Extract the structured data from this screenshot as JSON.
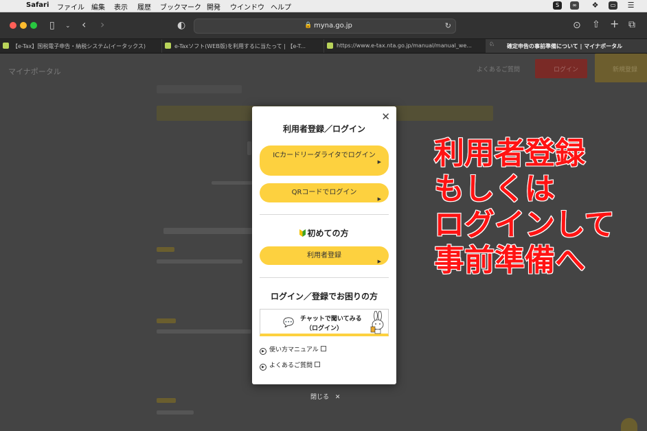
{
  "menubar": {
    "app": "Safari",
    "items": [
      "ファイル",
      "編集",
      "表示",
      "履歴",
      "ブックマーク",
      "開発",
      "ウインドウ",
      "ヘルプ"
    ]
  },
  "toolbar": {
    "url": "myna.go.jp"
  },
  "tabs": [
    {
      "label": "【e-Tax】国税電子申告・納税システム(イータックス)"
    },
    {
      "label": "e-Taxソフト(WEB版)を利用するに当たって | 【e-T..."
    },
    {
      "label": "https://www.e-tax.nta.go.jp/manual/manual_we..."
    },
    {
      "label": "確定申告の事前準備について | マイナポータル"
    }
  ],
  "background": {
    "logo": "マイナポータル",
    "faq": "よくあるご質問",
    "login": "ログイン",
    "register": "新規登録"
  },
  "modal": {
    "title": "利用者登録／ログイン",
    "ic_login": "ICカードリーダライタでログイン",
    "qr_login": "QRコードでログイン",
    "first_time_heading": "初めての方",
    "register_button": "利用者登録",
    "help_heading": "ログイン／登録でお困りの方",
    "chat_line1": "チャットで聞いてみる",
    "chat_line2": "（ログイン）",
    "manual_link": "使い方マニュアル",
    "faq_link": "よくあるご質問"
  },
  "close_below": "閉じる",
  "overlay_lines": [
    "利用者登録",
    "もしくは",
    "ログインして",
    "事前準備へ"
  ],
  "colors": {
    "accent_yellow": "#fdd13f",
    "overlay_red": "#ff1313",
    "beginner_green": "#3da12b"
  }
}
